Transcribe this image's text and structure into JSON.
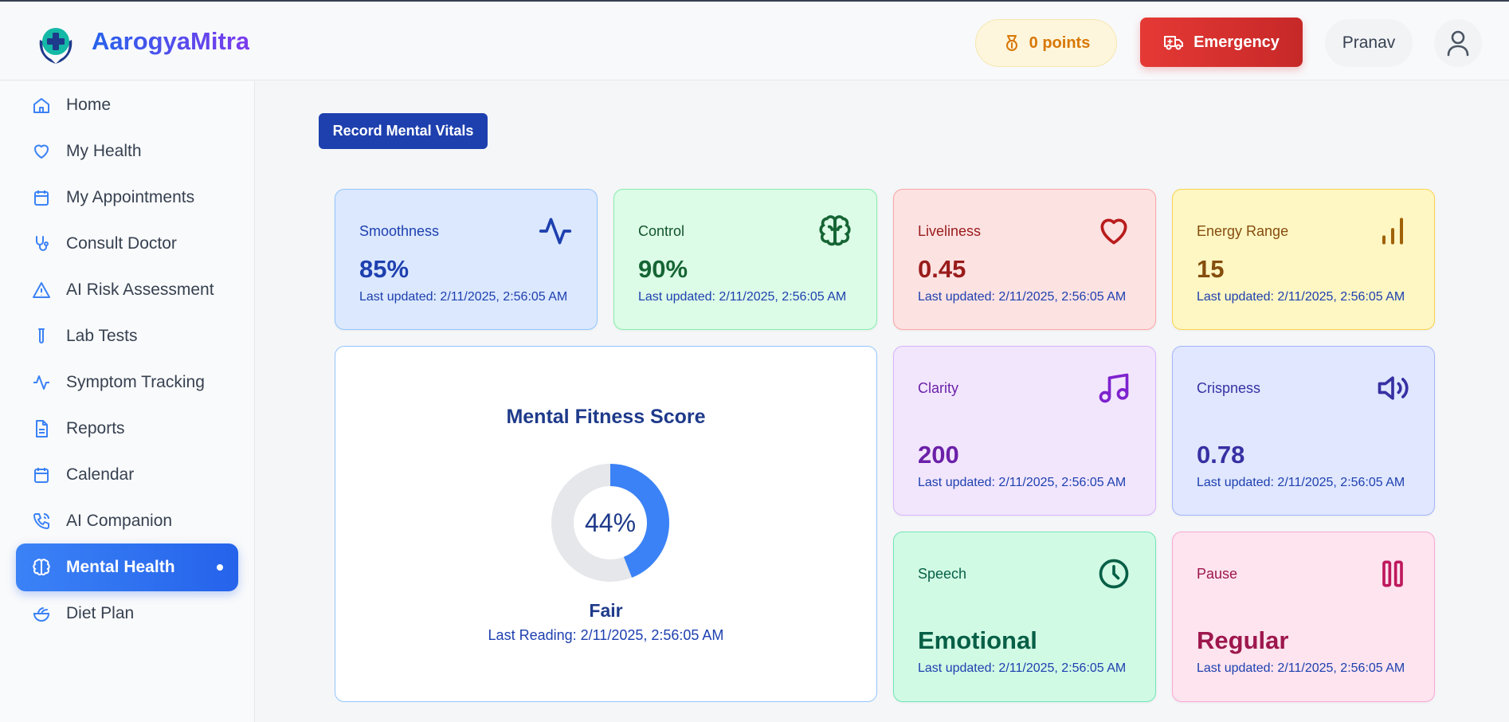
{
  "header": {
    "brand": "AarogyaMitra",
    "points": "0 points",
    "emergency": "Emergency",
    "user": "Pranav"
  },
  "sidebar": {
    "items": [
      {
        "label": "Home",
        "icon": "home-icon"
      },
      {
        "label": "My Health",
        "icon": "heart-icon"
      },
      {
        "label": "My Appointments",
        "icon": "calendar-icon"
      },
      {
        "label": "Consult Doctor",
        "icon": "stethoscope-icon"
      },
      {
        "label": "AI Risk Assessment",
        "icon": "warning-icon"
      },
      {
        "label": "Lab Tests",
        "icon": "test-tube-icon"
      },
      {
        "label": "Symptom Tracking",
        "icon": "activity-icon"
      },
      {
        "label": "Reports",
        "icon": "file-icon"
      },
      {
        "label": "Calendar",
        "icon": "calendar-icon"
      },
      {
        "label": "AI Companion",
        "icon": "phone-icon"
      },
      {
        "label": "Mental Health",
        "icon": "brain-icon",
        "active": true
      },
      {
        "label": "Diet Plan",
        "icon": "salad-icon"
      }
    ]
  },
  "main": {
    "record_button": "Record Mental Vitals",
    "metrics": {
      "smoothness": {
        "label": "Smoothness",
        "value": "85%",
        "updated": "Last updated: 2/11/2025, 2:56:05 AM"
      },
      "control": {
        "label": "Control",
        "value": "90%",
        "updated": "Last updated: 2/11/2025, 2:56:05 AM"
      },
      "liveliness": {
        "label": "Liveliness",
        "value": "0.45",
        "updated": "Last updated: 2/11/2025, 2:56:05 AM"
      },
      "energy": {
        "label": "Energy Range",
        "value": "15",
        "updated": "Last updated: 2/11/2025, 2:56:05 AM"
      },
      "clarity": {
        "label": "Clarity",
        "value": "200",
        "updated": "Last updated: 2/11/2025, 2:56:05 AM"
      },
      "crispness": {
        "label": "Crispness",
        "value": "0.78",
        "updated": "Last updated: 2/11/2025, 2:56:05 AM"
      },
      "speech": {
        "label": "Speech",
        "value": "Emotional",
        "updated": "Last updated: 2/11/2025, 2:56:05 AM"
      },
      "pause": {
        "label": "Pause",
        "value": "Regular",
        "updated": "Last updated: 2/11/2025, 2:56:05 AM"
      }
    },
    "score": {
      "title": "Mental Fitness Score",
      "percent": 44,
      "percent_label": "44%",
      "status": "Fair",
      "last_reading": "Last Reading: 2/11/2025, 2:56:05 AM"
    }
  },
  "colors": {
    "accent": "#2563eb",
    "emergency": "#dc2626",
    "points": "#d97706"
  }
}
